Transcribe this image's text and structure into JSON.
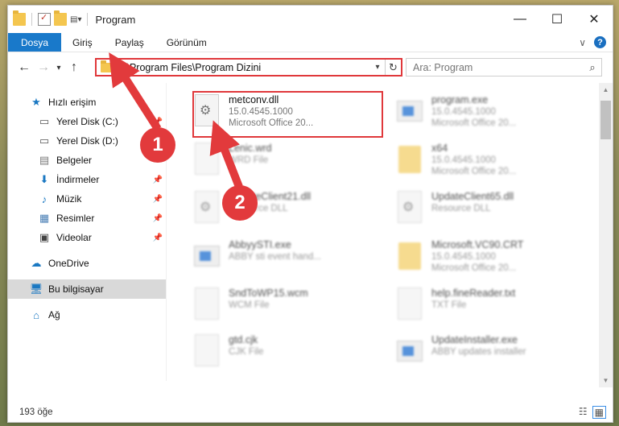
{
  "window": {
    "title": "Program",
    "controls": {
      "minimize": "—",
      "maximize": "☐",
      "close": "✕"
    }
  },
  "ribbon": {
    "tabs": [
      "Dosya",
      "Giriş",
      "Paylaş",
      "Görünüm"
    ],
    "expand": "∨",
    "help": "?"
  },
  "nav": {
    "back": "←",
    "forward": "→",
    "recent": "▾",
    "up": "↑",
    "address": "C:\\Program Files\\Program Dizini",
    "search_placeholder": "Ara: Program"
  },
  "sidebar": {
    "items": [
      {
        "label": "Hızlı erişim",
        "icon": "star-icon"
      },
      {
        "label": "Yerel Disk (C:)",
        "icon": "drive-icon",
        "pinned": true
      },
      {
        "label": "Yerel Disk (D:)",
        "icon": "drive-icon"
      },
      {
        "label": "Belgeler",
        "icon": "documents-icon"
      },
      {
        "label": "İndirmeler",
        "icon": "download-icon",
        "pinned": true
      },
      {
        "label": "Müzik",
        "icon": "music-icon",
        "pinned": true
      },
      {
        "label": "Resimler",
        "icon": "pictures-icon",
        "pinned": true
      },
      {
        "label": "Videolar",
        "icon": "videos-icon",
        "pinned": true
      },
      {
        "label": "OneDrive",
        "icon": "cloud-icon"
      },
      {
        "label": "Bu bilgisayar",
        "icon": "computer-icon",
        "selected": true
      },
      {
        "label": "Ağ",
        "icon": "network-icon"
      }
    ]
  },
  "files": [
    {
      "name": "metconv.dll",
      "line1": "15.0.4545.1000",
      "line2": "Microsoft Office 20...",
      "icon": "dll-icon"
    },
    {
      "name": "program.exe",
      "line1": "15.0.4545.1000",
      "line2": "Microsoft Office 20...",
      "icon": "exe-icon"
    },
    {
      "name": "Lenic.wrd",
      "line1": "WRD File",
      "line2": "",
      "icon": "file-icon"
    },
    {
      "name": "x64",
      "line1": "15.0.4545.1000",
      "line2": "Microsoft Office 20...",
      "icon": "folder-icon"
    },
    {
      "name": "UpdateClient21.dll",
      "line1": "Resource DLL",
      "line2": "",
      "icon": "dll-icon"
    },
    {
      "name": "UpdateClient65.dll",
      "line1": "Resource DLL",
      "line2": "",
      "icon": "dll-icon"
    },
    {
      "name": "AbbyySTI.exe",
      "line1": "ABBY sti event hand...",
      "line2": "",
      "icon": "exe-icon"
    },
    {
      "name": "Microsoft.VC90.CRT",
      "line1": "15.0.4545.1000",
      "line2": "Microsoft Office 20...",
      "icon": "folder-icon"
    },
    {
      "name": "SndToWP15.wcm",
      "line1": "WCM File",
      "line2": "",
      "icon": "file-icon"
    },
    {
      "name": "help.fineReader.txt",
      "line1": "TXT File",
      "line2": "",
      "icon": "file-icon"
    },
    {
      "name": "gtd.cjk",
      "line1": "CJK File",
      "line2": "",
      "icon": "file-icon"
    },
    {
      "name": "UpdateInstaller.exe",
      "line1": "ABBY updates installer",
      "line2": "",
      "icon": "exe-icon"
    }
  ],
  "status": {
    "count": "193 öğe"
  },
  "annotations": [
    {
      "label": "1"
    },
    {
      "label": "2"
    }
  ],
  "colors": {
    "accent": "#1979ca",
    "highlight": "#e0383b"
  }
}
